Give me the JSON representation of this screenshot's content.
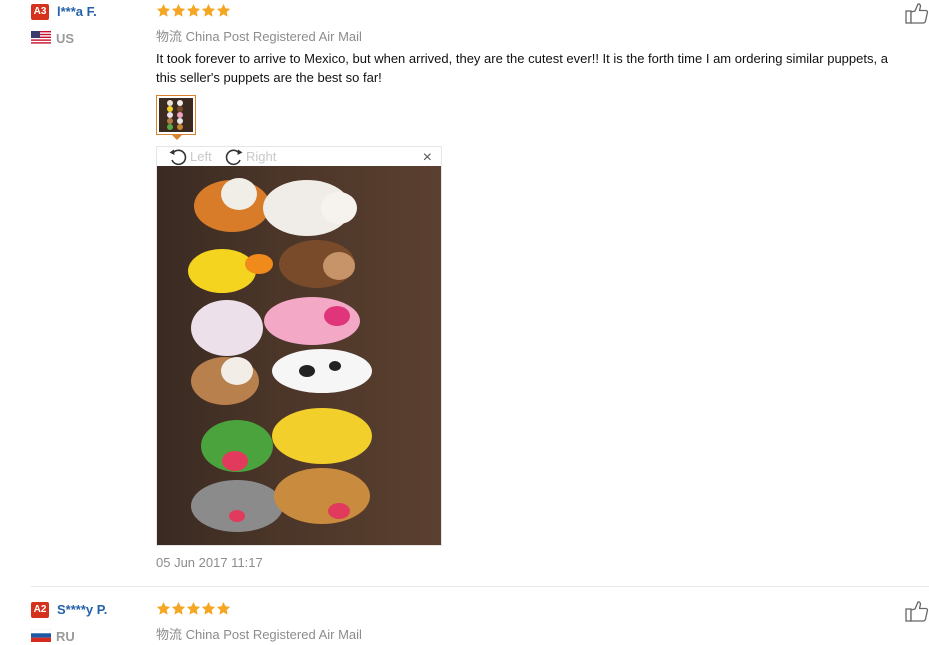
{
  "reviews": [
    {
      "badge": "A3",
      "username": "l***a F.",
      "country": "US",
      "rating": 5,
      "shipping": "物流 China Post Registered Air Mail",
      "text_line1": "It took forever to arrive to Mexico, but when arrived, they are the cutest ever!! It is the forth time I am ordering similar puppets, a",
      "text_line2": "this seller's puppets are the best so far!",
      "date": "05 Jun 2017 11:17",
      "viewer": {
        "rotate_left": "Left",
        "rotate_right": "Right",
        "close": "×"
      }
    },
    {
      "badge": "A2",
      "username": "S****y P.",
      "country": "RU",
      "rating": 5,
      "shipping": "物流 China Post Registered Air Mail"
    }
  ],
  "colors": {
    "badge": "#d5321d",
    "username": "#2461a8",
    "star": "#f5a623",
    "thumb_border": "#d8832f"
  },
  "icons": {
    "like": "thumbs-up-icon",
    "rotate_left": "rotate-left-icon",
    "rotate_right": "rotate-right-icon",
    "close": "close-icon"
  }
}
